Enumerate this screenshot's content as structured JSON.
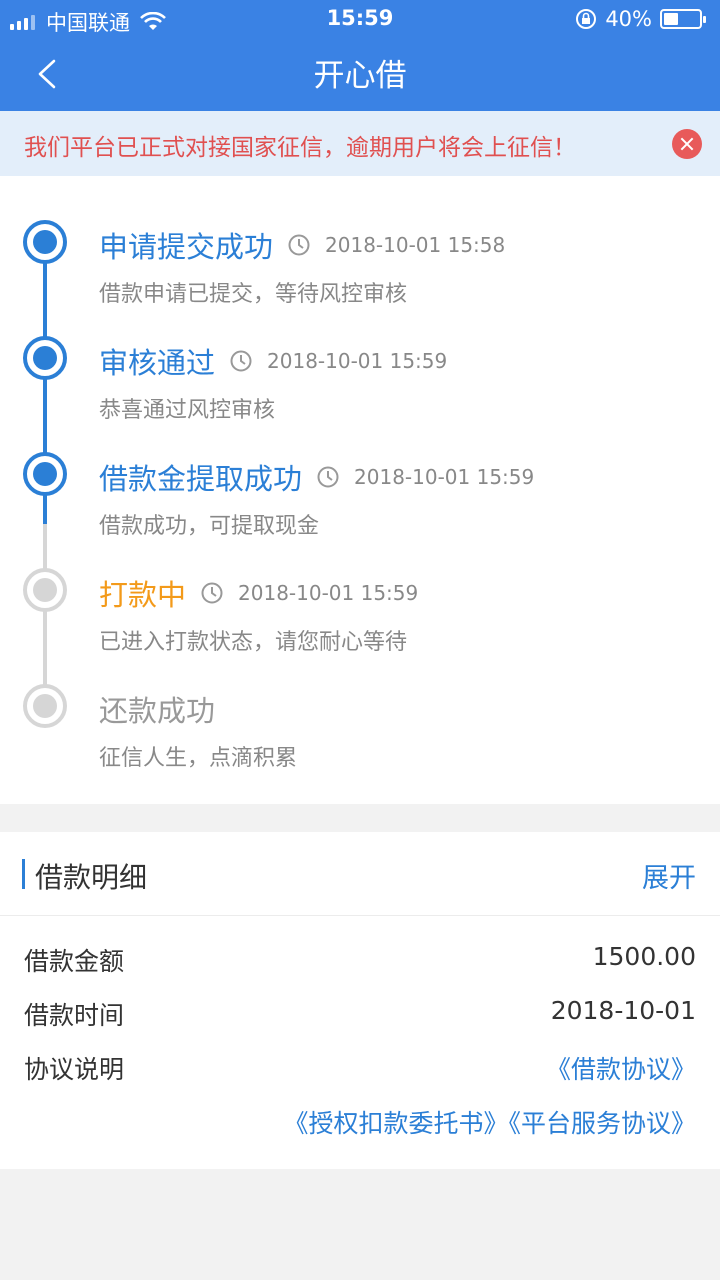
{
  "status_bar": {
    "carrier": "中国联通",
    "time": "15:59",
    "battery": "40%",
    "battery_level": 0.4
  },
  "nav": {
    "title": "开心借"
  },
  "notice": {
    "text": "我们平台已正式对接国家征信，逾期用户将会上征信！"
  },
  "steps": [
    {
      "title": "申请提交成功",
      "time": "2018-10-01 15:58",
      "desc": "借款申请已提交，等待风控审核",
      "state": "done",
      "color": "#2b7fd6"
    },
    {
      "title": "审核通过",
      "time": "2018-10-01 15:59",
      "desc": "恭喜通过风控审核",
      "state": "done",
      "color": "#2b7fd6"
    },
    {
      "title": "借款金提取成功",
      "time": "2018-10-01 15:59",
      "desc": "借款成功，可提取现金",
      "state": "done",
      "color": "#2b7fd6"
    },
    {
      "title": "打款中",
      "time": "2018-10-01 15:59",
      "desc": "已进入打款状态，请您耐心等待",
      "state": "current",
      "color": "#f39a1a"
    },
    {
      "title": "还款成功",
      "time": "",
      "desc": "征信人生，点滴积累",
      "state": "pending",
      "color": "#999999"
    }
  ],
  "detail": {
    "title": "借款明细",
    "expand_label": "展开",
    "amount_label": "借款金额",
    "amount_value": "1500.00",
    "date_label": "借款时间",
    "date_value": "2018-10-01",
    "agreement_label": "协议说明",
    "agreement_links": [
      "《借款协议》",
      "《授权扣款委托书》",
      "《平台服务协议》"
    ]
  }
}
